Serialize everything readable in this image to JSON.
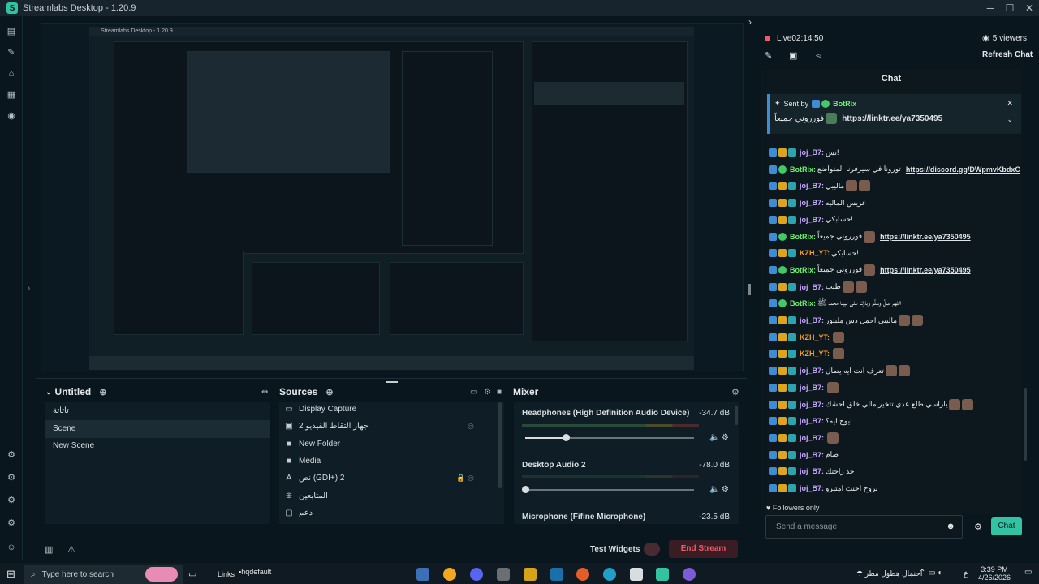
{
  "window": {
    "title": "Streamlabs Desktop - 1.20.9",
    "controls": [
      "─",
      "☐",
      "✕"
    ]
  },
  "nested": {
    "title": "Streamlabs Desktop - 1.20.9"
  },
  "scenes": {
    "title": "Untitled",
    "items": [
      "تاتاتة",
      "Scene",
      "New Scene"
    ],
    "active_index": 1
  },
  "sources": {
    "title": "Sources",
    "items": [
      {
        "icon": "monitor-icon",
        "label": "Display Capture"
      },
      {
        "icon": "camera-icon",
        "label": "جهاز التقاط الفيديو 2"
      },
      {
        "icon": "folder-icon",
        "label": "New Folder"
      },
      {
        "icon": "folder-icon",
        "label": "Media"
      },
      {
        "icon": "text-icon",
        "label": "نص (GDI+) 2"
      },
      {
        "icon": "globe-icon",
        "label": "المتابعين"
      },
      {
        "icon": "image-icon",
        "label": "دعم"
      }
    ]
  },
  "mixer": {
    "title": "Mixer",
    "channels": [
      {
        "name": "Headphones (High Definition Audio Device)",
        "db": "-34.7 dB",
        "level": 0.24
      },
      {
        "name": "Desktop Audio 2",
        "db": "-78.0 dB",
        "level": 0.0
      },
      {
        "name": "Microphone (Fifine Microphone)",
        "db": "-23.5 dB"
      }
    ]
  },
  "footer": {
    "test_widgets": "Test Widgets",
    "end_stream": "End Stream"
  },
  "stream": {
    "status": "Live",
    "time": "02:14:50",
    "viewers": "5 viewers",
    "refresh": "Refresh Chat"
  },
  "chat": {
    "header": "Chat",
    "pinned": {
      "sent_by": "Sent by",
      "user": "BotRix",
      "message": "فورروني جميعاً",
      "link": "https://linktr.ee/ya7350495"
    },
    "messages": [
      {
        "user": "joj_B7",
        "color": "#c9a8ff",
        "badges": [
          "b1",
          "b2",
          "b3"
        ],
        "text": "نس!"
      },
      {
        "user": "BotRix",
        "color": "#6ef06e",
        "badges": [
          "b1",
          "b4"
        ],
        "text": "تورونا في سيرفرنا المتواضع",
        "link": "https://discord.gg/DWpmvKbdxC"
      },
      {
        "user": "joj_B7",
        "color": "#c9a8ff",
        "badges": [
          "b1",
          "b2",
          "b3"
        ],
        "text": "ماليبي",
        "emotes": 2
      },
      {
        "user": "joj_B7",
        "color": "#c9a8ff",
        "badges": [
          "b1",
          "b2",
          "b3"
        ],
        "text": "عريس الماليه"
      },
      {
        "user": "joj_B7",
        "color": "#c9a8ff",
        "badges": [
          "b1",
          "b2",
          "b3"
        ],
        "text": "حسابكي!"
      },
      {
        "user": "BotRix",
        "color": "#6ef06e",
        "badges": [
          "b1",
          "b4"
        ],
        "text": "فورروني جميعاً",
        "link": "https://linktr.ee/ya7350495",
        "emotes": 1
      },
      {
        "user": "KZH_YT",
        "color": "#ff9f1c",
        "badges": [
          "b1",
          "b2",
          "b3"
        ],
        "text": "حسابكي!"
      },
      {
        "user": "BotRix",
        "color": "#6ef06e",
        "badges": [
          "b1",
          "b4"
        ],
        "text": "فورروني جميعاً",
        "link": "https://linktr.ee/ya7350495",
        "emotes": 1
      },
      {
        "user": "joj_B7",
        "color": "#c9a8ff",
        "badges": [
          "b1",
          "b2",
          "b3"
        ],
        "text": "طيب",
        "emotes": 2
      },
      {
        "user": "BotRix",
        "color": "#6ef06e",
        "badges": [
          "b1",
          "b4"
        ],
        "text": "اللهم صلِّ وسلِّم وبارك على نبينا محمد ﷺ"
      },
      {
        "user": "joj_B7",
        "color": "#c9a8ff",
        "badges": [
          "b1",
          "b2",
          "b3"
        ],
        "text": "ماليبي احمل دس مليتور",
        "emotes": 2
      },
      {
        "user": "KZH_YT",
        "color": "#ff9f1c",
        "badges": [
          "b1",
          "b2",
          "b3"
        ],
        "text": "",
        "emotes": 1
      },
      {
        "user": "KZH_YT",
        "color": "#ff9f1c",
        "badges": [
          "b1",
          "b2",
          "b3"
        ],
        "text": "",
        "emotes": 1
      },
      {
        "user": "joj_B7",
        "color": "#c9a8ff",
        "badges": [
          "b1",
          "b2",
          "b3"
        ],
        "text": "تعرف انت ايه يصال",
        "emotes": 2
      },
      {
        "user": "joj_B7",
        "color": "#c9a8ff",
        "badges": [
          "b1",
          "b2",
          "b3"
        ],
        "text": "",
        "emotes": 1
      },
      {
        "user": "joj_B7",
        "color": "#c9a8ff",
        "badges": [
          "b1",
          "b2",
          "b3"
        ],
        "text": "ياراسي طلع عدي تتخير مالي خلق احشك",
        "emotes": 2
      },
      {
        "user": "joj_B7",
        "color": "#c9a8ff",
        "badges": [
          "b1",
          "b2",
          "b3"
        ],
        "text": "ايوح ايه؟"
      },
      {
        "user": "joj_B7",
        "color": "#c9a8ff",
        "badges": [
          "b1",
          "b2",
          "b3"
        ],
        "text": "",
        "emotes": 1
      },
      {
        "user": "joj_B7",
        "color": "#c9a8ff",
        "badges": [
          "b1",
          "b2",
          "b3"
        ],
        "text": "صام"
      },
      {
        "user": "joj_B7",
        "color": "#c9a8ff",
        "badges": [
          "b1",
          "b2",
          "b3"
        ],
        "text": "خذ راحتك"
      },
      {
        "user": "joj_B7",
        "color": "#c9a8ff",
        "badges": [
          "b1",
          "b2",
          "b3"
        ],
        "text": "بروح احنث امتيرو"
      }
    ],
    "followers_only": "Followers only",
    "input_placeholder": "Send a message",
    "send_label": "Chat"
  },
  "taskbar": {
    "search_placeholder": "Type here to search",
    "links": "Links",
    "hq": "hqdefault",
    "weather": "احتمال هطول مطر",
    "lang": "ع",
    "time": "3:39 PM",
    "date": "4/26/2026"
  },
  "colors": {
    "accent": "#31c3a2",
    "live": "#f05a63",
    "bg": "#09161d"
  }
}
